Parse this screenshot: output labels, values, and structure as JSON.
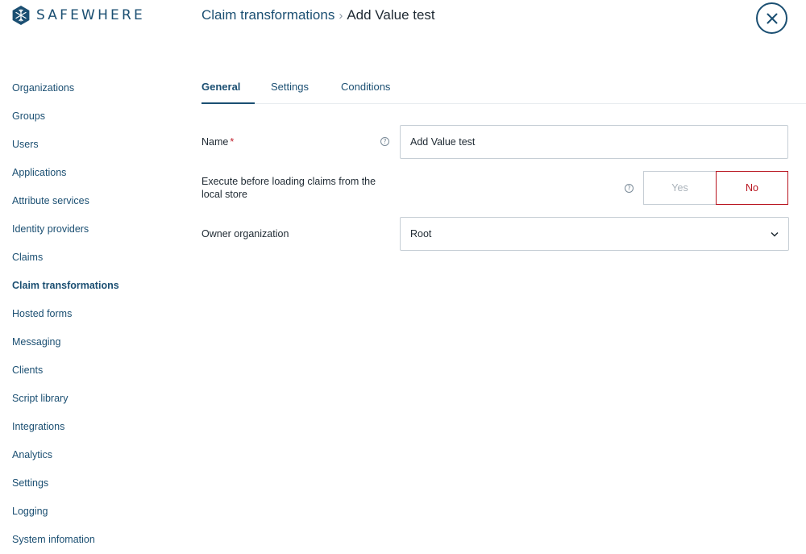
{
  "brand": {
    "name": "SAFEWHERE",
    "color": "#1b4f72"
  },
  "breadcrumb": {
    "parent": "Claim transformations",
    "separator": "›",
    "current": "Add Value test"
  },
  "close_icon": "close-icon",
  "sidebar": {
    "items": [
      {
        "label": "Organizations"
      },
      {
        "label": "Groups"
      },
      {
        "label": "Users"
      },
      {
        "label": "Applications"
      },
      {
        "label": "Attribute services"
      },
      {
        "label": "Identity providers"
      },
      {
        "label": "Claims"
      },
      {
        "label": "Claim transformations",
        "active": true
      },
      {
        "label": "Hosted forms"
      },
      {
        "label": "Messaging"
      },
      {
        "label": "Clients"
      },
      {
        "label": "Script library"
      },
      {
        "label": "Integrations"
      },
      {
        "label": "Analytics"
      },
      {
        "label": "Settings"
      },
      {
        "label": "Logging"
      },
      {
        "label": "System infomation"
      }
    ]
  },
  "tabs": [
    {
      "label": "General",
      "active": true
    },
    {
      "label": "Settings"
    },
    {
      "label": "Conditions"
    }
  ],
  "form": {
    "name": {
      "label": "Name",
      "required_mark": "*",
      "value": "Add Value test",
      "help": "?"
    },
    "execute_before": {
      "label_line1": "Execute before loading claims from the",
      "label_line2": "local store",
      "help": "?",
      "options": [
        "Yes",
        "No"
      ],
      "selected": "No"
    },
    "owner": {
      "label": "Owner organization",
      "value": "Root"
    }
  },
  "colors": {
    "accent": "#1b4f72",
    "danger": "#b8141f",
    "border": "#c6ced5"
  }
}
